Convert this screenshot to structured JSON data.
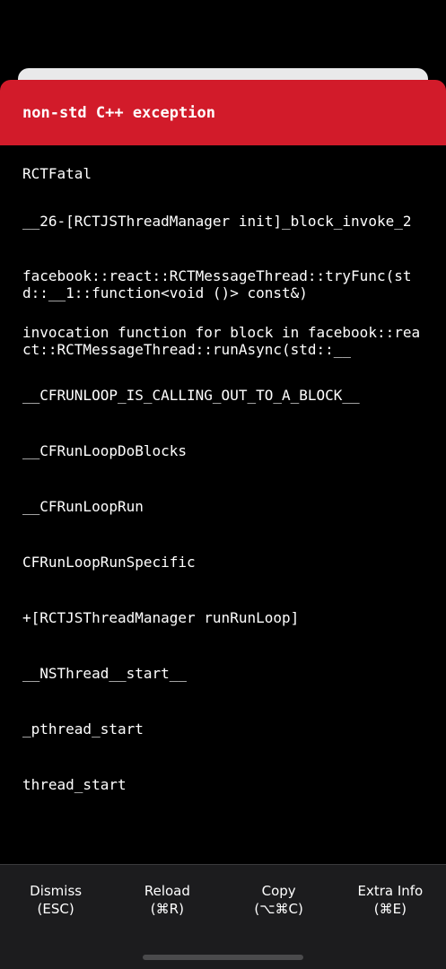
{
  "error": {
    "title": "non-std C++ exception"
  },
  "stack_frames": [
    "RCTFatal",
    "__26-[RCTJSThreadManager init]_block_invoke_2",
    "facebook::react::RCTMessageThread::tryFunc(std::__1::function<void ()> const&)",
    "invocation function for block in facebook::react::RCTMessageThread::runAsync(std::__",
    "__CFRUNLOOP_IS_CALLING_OUT_TO_A_BLOCK__",
    "__CFRunLoopDoBlocks",
    "__CFRunLoopRun",
    "CFRunLoopRunSpecific",
    "+[RCTJSThreadManager runRunLoop]",
    "__NSThread__start__",
    "_pthread_start",
    "thread_start"
  ],
  "footer": {
    "dismiss": {
      "label": "Dismiss",
      "shortcut": "(ESC)"
    },
    "reload": {
      "label": "Reload",
      "shortcut": "(⌘R)"
    },
    "copy": {
      "label": "Copy",
      "shortcut": "(⌥⌘C)"
    },
    "extra_info": {
      "label": "Extra Info",
      "shortcut": "(⌘E)"
    }
  },
  "colors": {
    "header_red": "#d21b2a",
    "background": "#000000",
    "footer": "#1c1c1e"
  }
}
